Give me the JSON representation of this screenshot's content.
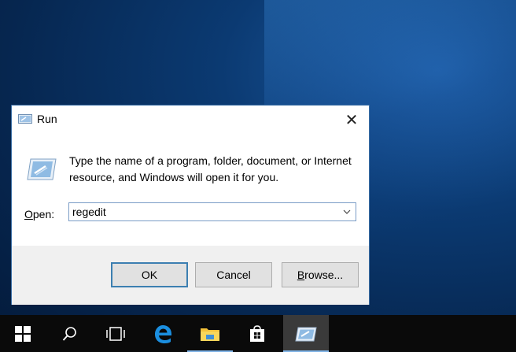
{
  "dialog": {
    "title": "Run",
    "close_symbol": "✕",
    "description": "Type the name of a program, folder, document, or Internet resource, and Windows will open it for you.",
    "open_label_accel": "O",
    "open_label_rest": "pen:",
    "open_value": "regedit",
    "buttons": {
      "ok": "OK",
      "cancel": "Cancel",
      "browse_accel": "B",
      "browse_rest": "rowse..."
    }
  },
  "taskbar": {
    "items": [
      {
        "icon": "windows-start-icon"
      },
      {
        "icon": "search-icon"
      },
      {
        "icon": "task-view-icon"
      },
      {
        "icon": "edge-browser-icon"
      },
      {
        "icon": "file-explorer-icon"
      },
      {
        "icon": "store-icon"
      },
      {
        "icon": "run-app-icon",
        "active": true
      }
    ]
  },
  "colors": {
    "accent_border": "#3c7fb1",
    "taskbar_bg": "#0a0a0a",
    "desktop_blue": "#0b3a72"
  }
}
